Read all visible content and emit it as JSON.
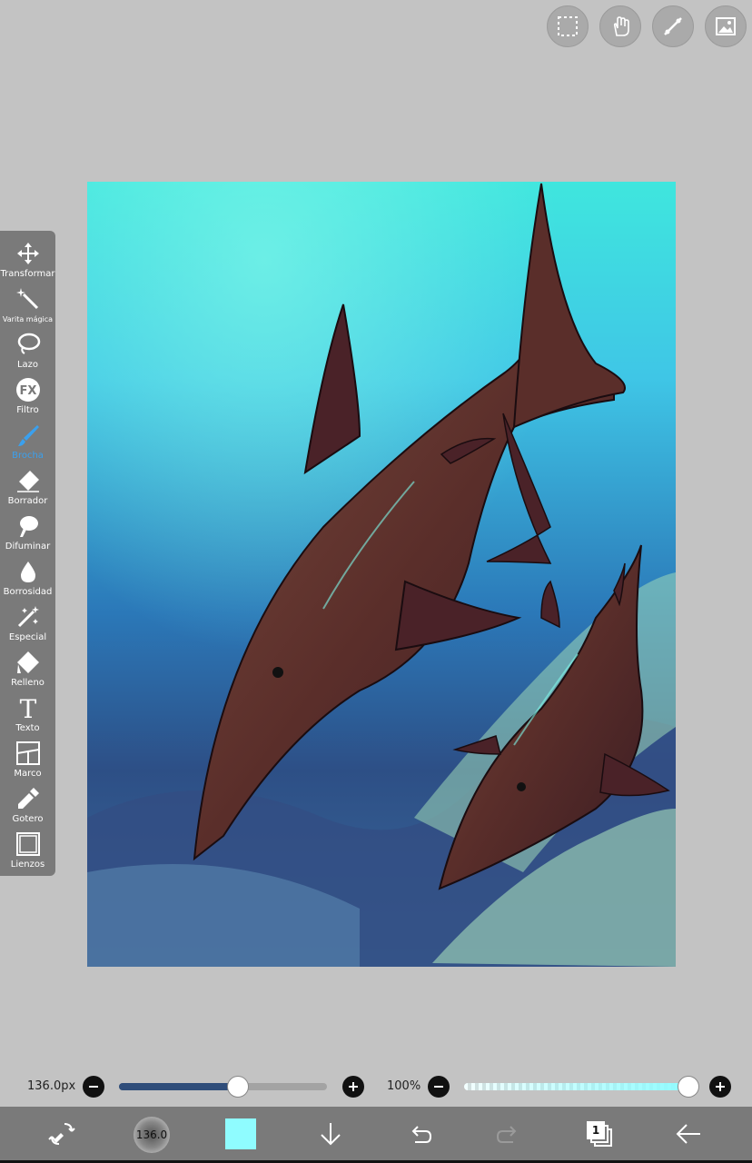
{
  "top_buttons": [
    {
      "name": "selection-icon"
    },
    {
      "name": "hand-tool-icon"
    },
    {
      "name": "ruler-icon"
    },
    {
      "name": "image-icon"
    }
  ],
  "tools": [
    {
      "name": "transform",
      "label": "Transformar",
      "icon": "move-icon"
    },
    {
      "name": "magic-wand",
      "label": "Varita mágica",
      "icon": "magic-wand-icon"
    },
    {
      "name": "lasso",
      "label": "Lazo",
      "icon": "lasso-icon"
    },
    {
      "name": "filter",
      "label": "Filtro",
      "icon": "fx-icon"
    },
    {
      "name": "brush",
      "label": "Brocha",
      "icon": "brush-icon",
      "active": true
    },
    {
      "name": "eraser",
      "label": "Borrador",
      "icon": "eraser-icon"
    },
    {
      "name": "smudge",
      "label": "Difuminar",
      "icon": "smudge-icon"
    },
    {
      "name": "blur",
      "label": "Borrosidad",
      "icon": "drop-icon"
    },
    {
      "name": "special",
      "label": "Especial",
      "icon": "sparkle-icon"
    },
    {
      "name": "fill",
      "label": "Relleno",
      "icon": "fill-icon"
    },
    {
      "name": "text",
      "label": "Texto",
      "icon": "text-icon"
    },
    {
      "name": "frame",
      "label": "Marco",
      "icon": "frame-icon"
    },
    {
      "name": "eyedropper",
      "label": "Gotero",
      "icon": "eyedropper-icon"
    },
    {
      "name": "canvas",
      "label": "Lienzos",
      "icon": "canvas-icon"
    }
  ],
  "brush_size": {
    "value_text": "136.0px",
    "level": 0.57
  },
  "opacity": {
    "value_text": "100%",
    "level": 1.0
  },
  "bottom_bar": {
    "brush_preview_text": "136.0",
    "color": "#8ffcff",
    "layer_count": "1"
  },
  "colors": {
    "active_tool": "#3aa0ee",
    "toolbar_bg": "#7a7a7a",
    "app_bg": "#c3c3c3"
  }
}
